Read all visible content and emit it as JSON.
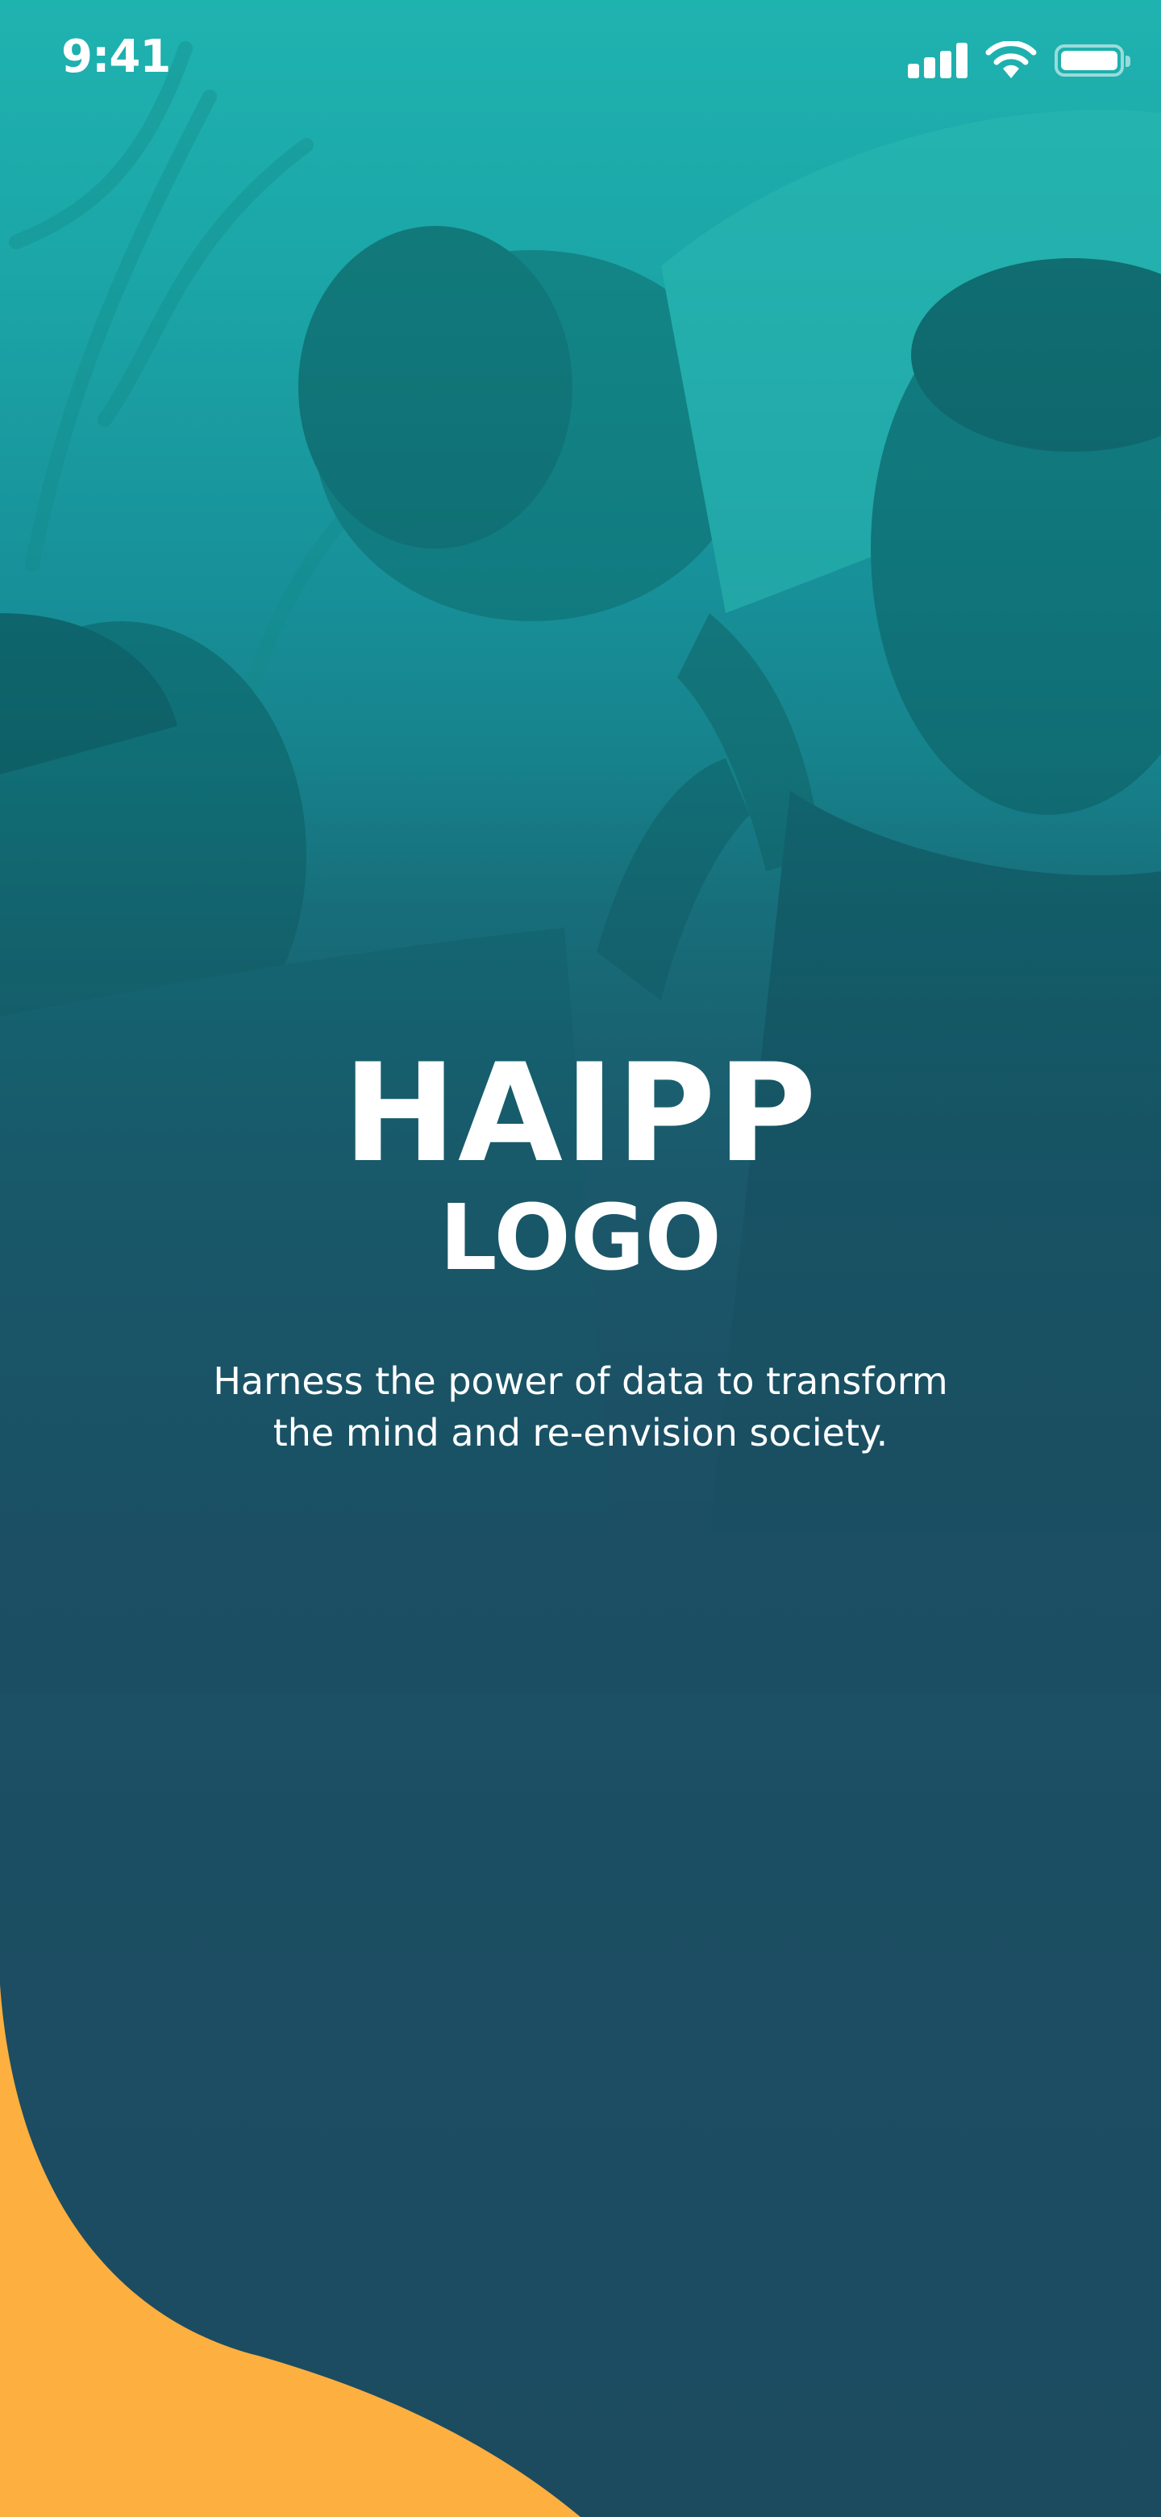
{
  "status_bar": {
    "time": "9:41",
    "icons": [
      "cellular-signal-icon",
      "wifi-icon",
      "battery-icon"
    ]
  },
  "splash": {
    "logo_title": "HAIPP",
    "logo_subtitle": "LOGO",
    "tagline_line1": "Harness the power of data to transform",
    "tagline_line2": "the mind and re-envision society."
  },
  "colors": {
    "teal_top": "#1fb3b0",
    "navy_bottom": "#1c4b60",
    "accent_orange": "#fdaf3f",
    "text": "#ffffff"
  }
}
